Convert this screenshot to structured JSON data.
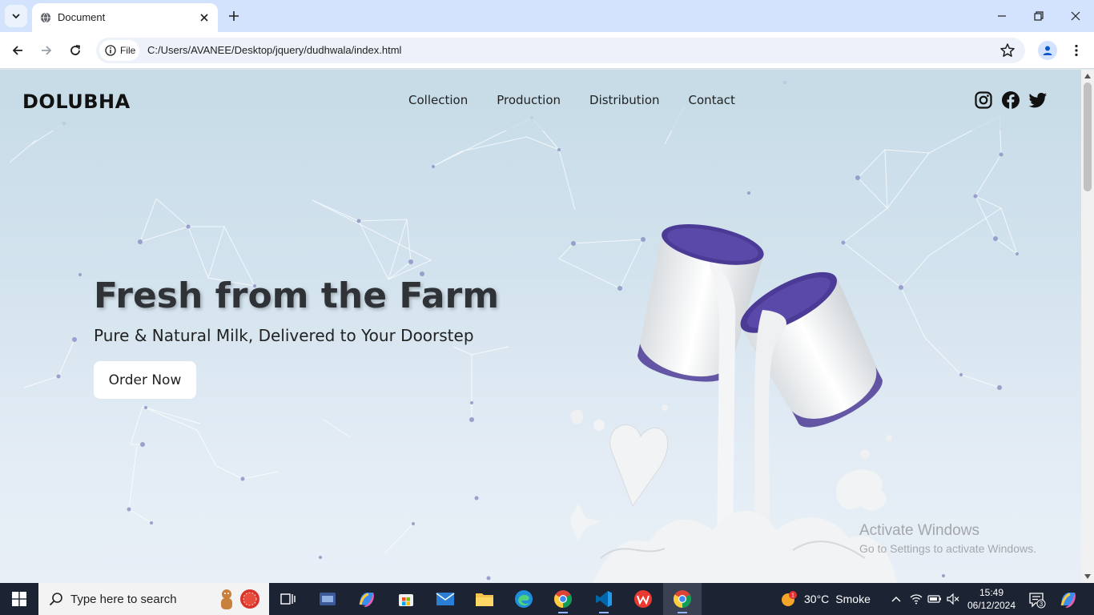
{
  "browser": {
    "tab_title": "Document",
    "file_chip_label": "File",
    "url": "C:/Users/AVANEE/Desktop/jquery/dudhwala/index.html"
  },
  "site": {
    "logo": "DOLUBHA",
    "nav": [
      "Collection",
      "Production",
      "Distribution",
      "Contact"
    ],
    "social_icons": [
      "instagram-icon",
      "facebook-icon",
      "twitter-icon"
    ],
    "hero": {
      "title": "Fresh from the Farm",
      "subtitle": "Pure & Natural Milk, Delivered to Your Doorstep",
      "cta": "Order Now"
    }
  },
  "watermark": {
    "line1": "Activate Windows",
    "line2": "Go to Settings to activate Windows."
  },
  "taskbar": {
    "search_placeholder": "Type here to search",
    "weather_temp": "30°C",
    "weather_desc": "Smoke",
    "weather_badge": "1",
    "time": "15:49",
    "date": "06/12/2024",
    "notification_count": "3"
  },
  "colors": {
    "tabbar": "#d3e3fd",
    "page_bg_top": "#c6dbe7",
    "page_bg_bottom": "#e8eff7",
    "cup_purple": "#4b3b96",
    "taskbar": "#1c2333"
  }
}
